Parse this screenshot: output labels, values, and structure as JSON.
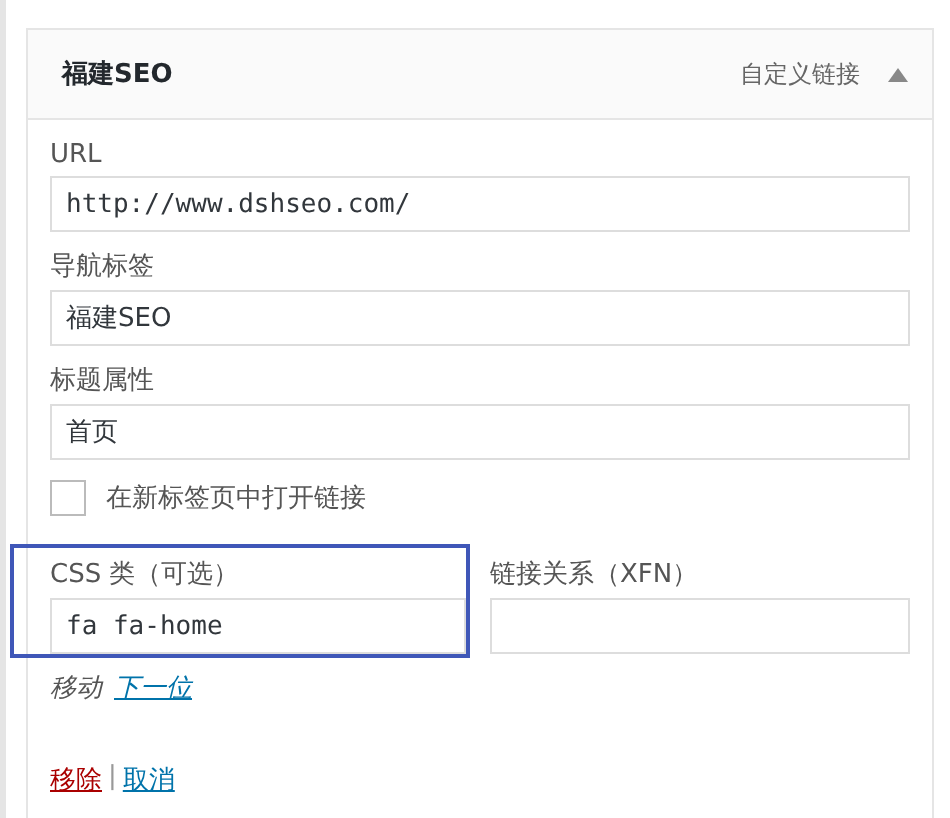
{
  "menu_item": {
    "title": "福建SEO",
    "type": "自定义链接",
    "expanded": true
  },
  "fields": [
    {
      "label": "URL",
      "value": "http://www.dshseo.com/",
      "mono": true
    },
    {
      "label": "导航标签",
      "value": "福建SEO",
      "mono": false
    },
    {
      "label": "标题属性",
      "value": "首页",
      "mono": false
    }
  ],
  "new_tab": {
    "label": "在新标签页中打开链接",
    "checked": false
  },
  "half_fields": [
    {
      "label": "CSS 类（可选）",
      "value": "fa fa-home",
      "highlighted": true
    },
    {
      "label": "链接关系（XFN）",
      "highlighted": false
    }
  ],
  "move": {
    "label": "移动",
    "link": "下一位"
  },
  "actions": {
    "remove": "移除",
    "separator": "|",
    "cancel": "取消"
  }
}
